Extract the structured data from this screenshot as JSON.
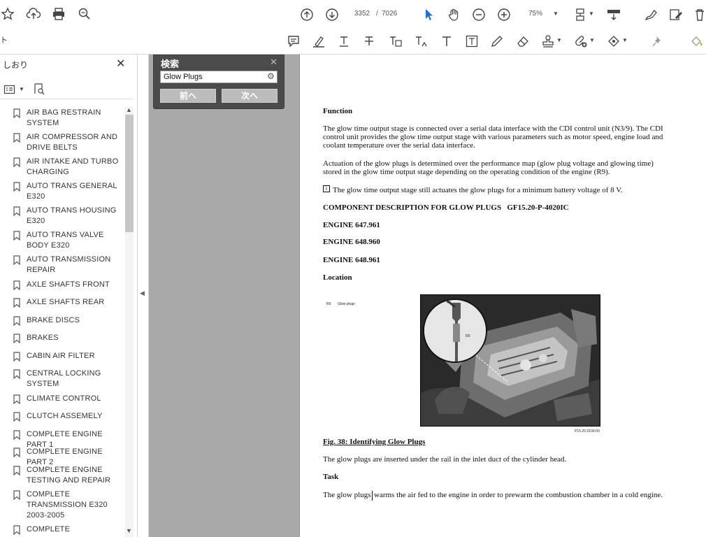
{
  "toolbar": {
    "page_current": "3352",
    "page_separator": "/",
    "page_total": "7026",
    "zoom": "75%",
    "left_cut_char": "ト"
  },
  "sidebar": {
    "title": "しおり",
    "bookmarks": [
      {
        "label": "AIR BAG RESTRAIN SYSTEM"
      },
      {
        "label": "AIR COMPRESSOR AND DRIVE BELTS"
      },
      {
        "label": "AIR INTAKE AND TURBO CHARGING"
      },
      {
        "label": "AUTO TRANS GENERAL E320"
      },
      {
        "label": "AUTO TRANS HOUSING E320"
      },
      {
        "label": "AUTO TRANS VALVE BODY E320"
      },
      {
        "label": "AUTO TRANSMISSION REPAIR"
      },
      {
        "label": "AXLE SHAFTS FRONT"
      },
      {
        "label": "AXLE SHAFTS REAR"
      },
      {
        "label": "BRAKE DISCS"
      },
      {
        "label": "BRAKES"
      },
      {
        "label": "CABIN AIR FILTER"
      },
      {
        "label": "CENTRAL LOCKING SYSTEM"
      },
      {
        "label": "CLIMATE CONTROL"
      },
      {
        "label": "CLUTCH ASSEMELY"
      },
      {
        "label": "COMPLETE ENGINE PART 1"
      },
      {
        "label": "COMPLETE ENGINE PART 2"
      },
      {
        "label": "COMPLETE ENGINE TESTING AND REPAIR"
      },
      {
        "label": "COMPLETE TRANSMISSION E320 2003-2005"
      },
      {
        "label": "COMPLETE"
      }
    ]
  },
  "search": {
    "title": "検索",
    "query": "Glow Plugs",
    "prev_label": "前へ",
    "next_label": "次へ"
  },
  "document": {
    "heading_function": "Function",
    "para1_l1": "The glow time output stage is connected over a serial data interface with the CDI control unit (N3/9). The CDI",
    "para1_l2": "control unit provides the glow time output stage with various parameters such as motor speed, engine load and",
    "para1_l3": "coolant temperature over the serial data interface.",
    "para2_l1": "Actuation of the glow plugs is determined over the performance map (glow plug voltage and glowing time)",
    "para2_l2": "stored in the glow time output stage depending on the operating condition of the engine (R9).",
    "note_icon": "i",
    "note": "The glow time output stage still actuates the glow plugs for a minimum battery voltage of 8 V.",
    "component_heading": "COMPONENT DESCRIPTION FOR GLOW PLUGS   GF15.20-P-4020IC",
    "engine1": "ENGINE 647.961",
    "engine2": "ENGINE 648.960",
    "engine3": "ENGINE 648.961",
    "location": "Location",
    "legend_code": "R9",
    "legend_text": "Glow plugs",
    "photo_callout": "R9",
    "photo_id": "P15.20-2109-00",
    "fig_caption": "Fig. 38: Identifying Glow Plugs",
    "para3": "The glow plugs are inserted under the rail in the inlet duct of the cylinder head.",
    "task": "Task",
    "para4_a": "The glow plugs",
    "para4_b": "warms the air fed to the engine in order to prewarm the combustion chamber in a cold engine."
  }
}
